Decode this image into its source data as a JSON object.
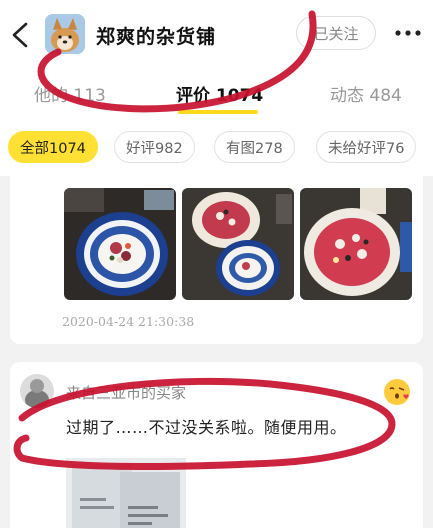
{
  "header": {
    "shop_name": "郑爽的杂货铺",
    "follow_label": "已关注"
  },
  "tabs": [
    {
      "label": "他的 113"
    },
    {
      "label": "评价 1074",
      "active": true
    },
    {
      "label": "动态 484"
    }
  ],
  "filters": [
    {
      "label": "全部1074",
      "active": true
    },
    {
      "label": "好评982"
    },
    {
      "label": "有图278"
    },
    {
      "label": "未给好评76"
    }
  ],
  "review1": {
    "timestamp": "2020-04-24 21:30:38"
  },
  "review2": {
    "reviewer": "来自三亚市的买家",
    "text": "过期了……不过没关系啦。随便用用。"
  },
  "colors": {
    "accent_yellow": "#ffe033",
    "annotation_red": "#c8102e"
  },
  "icons": [
    "back-arrow-icon",
    "more-dots-icon",
    "kiss-emoji-icon"
  ]
}
